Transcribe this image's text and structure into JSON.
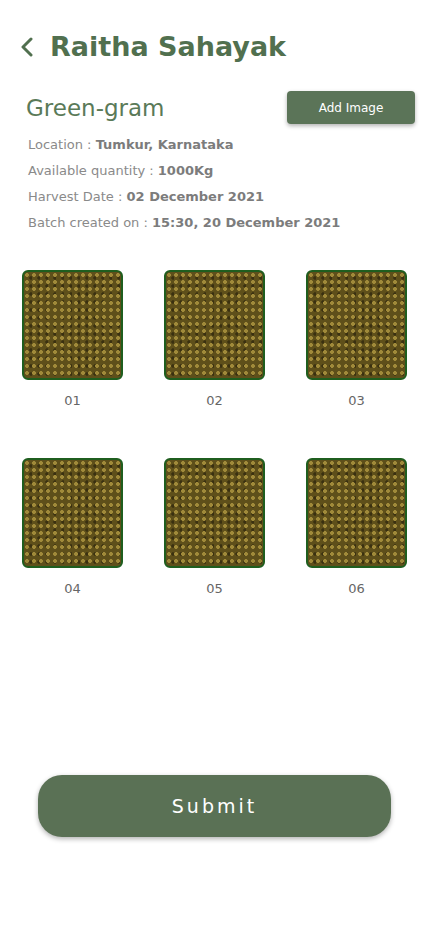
{
  "header": {
    "title": "Raitha Sahayak"
  },
  "crop": {
    "name": "Green-gram"
  },
  "add_button": "Add Image",
  "details": [
    {
      "label": "Location :",
      "value": "Tumkur, Karnataka"
    },
    {
      "label": "Available quantity :",
      "value": "1000Kg"
    },
    {
      "label": "Harvest Date :",
      "value": "02 December 2021"
    },
    {
      "label": "Batch created on :",
      "value": "15:30, 20 December 2021"
    }
  ],
  "images": [
    {
      "label": "01"
    },
    {
      "label": "02"
    },
    {
      "label": "03"
    },
    {
      "label": "04"
    },
    {
      "label": "05"
    },
    {
      "label": "06"
    }
  ],
  "submit_button": "Submit"
}
